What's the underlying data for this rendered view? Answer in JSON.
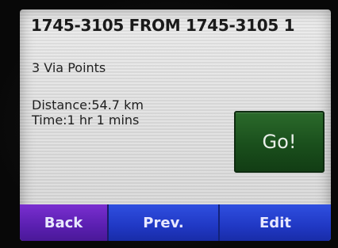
{
  "route": {
    "title": "1745-3105 FROM 1745-3105 1",
    "via_points": "3 Via Points",
    "distance": "Distance:54.7 km",
    "time": "Time:1 hr 1 mins"
  },
  "actions": {
    "go_label": "Go!"
  },
  "bottom_bar": {
    "back_label": "Back",
    "prev_label": "Prev.",
    "edit_label": "Edit"
  },
  "colors": {
    "go_button": "#1a4f1c",
    "back_button": "#5a1fb0",
    "nav_buttons": "#2038c4",
    "screen_background": "#e3e3e3"
  }
}
